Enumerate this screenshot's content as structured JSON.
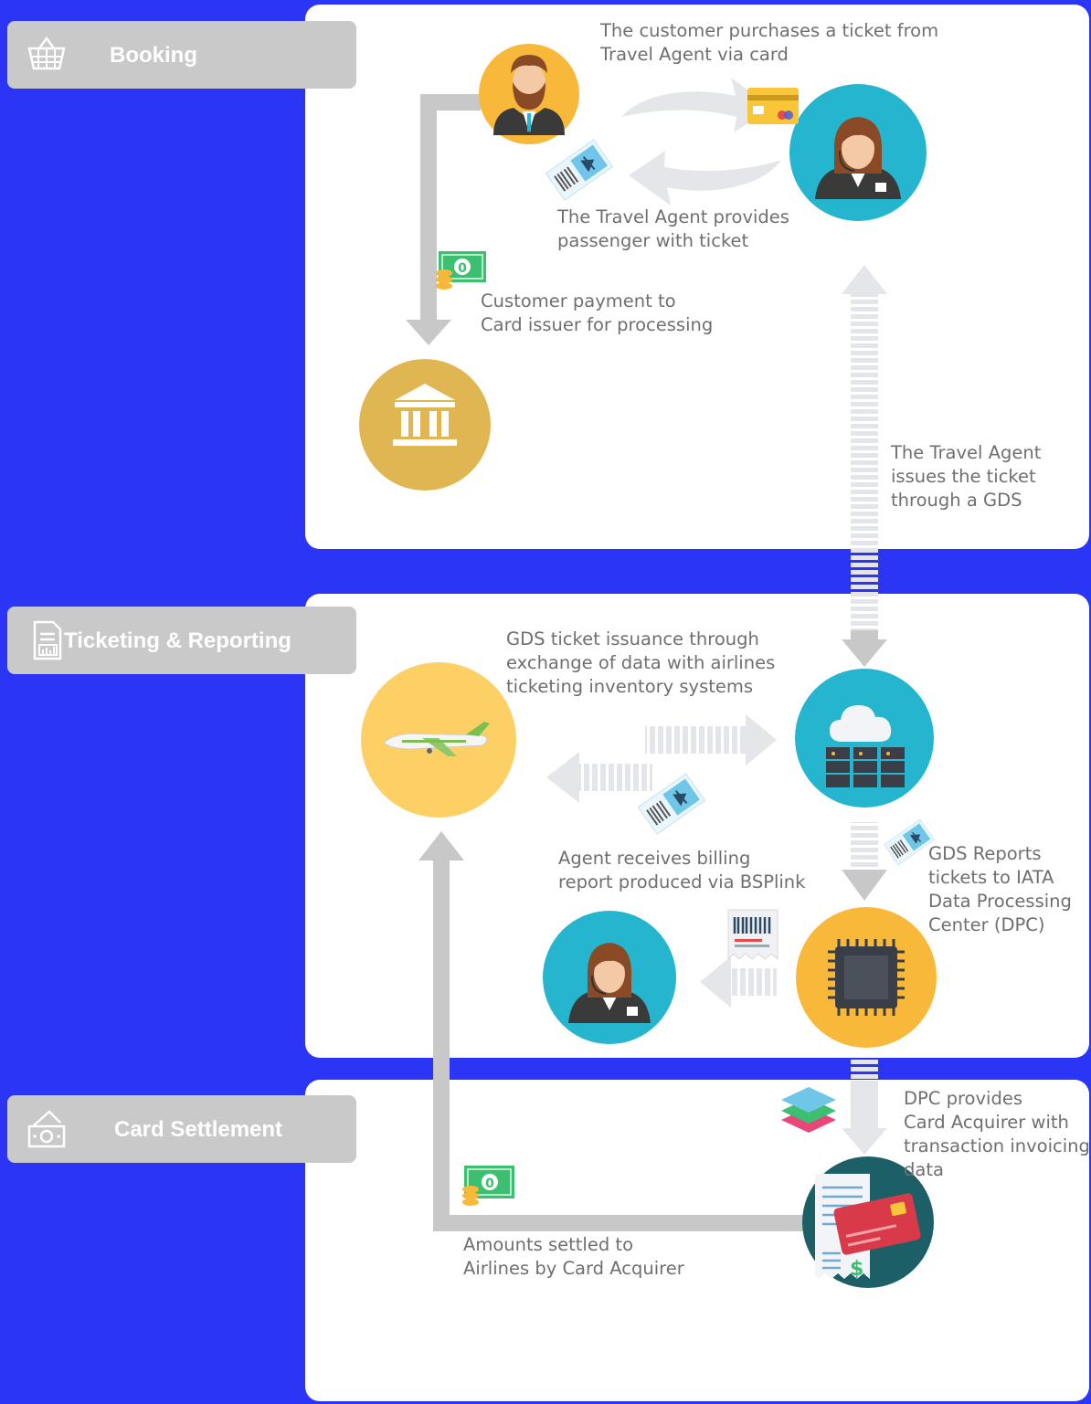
{
  "sections": {
    "booking": "Booking",
    "ticketing": "Ticketing & Reporting",
    "settlement": "Card Settlement"
  },
  "annotations": {
    "purchase": "The customer purchases a ticket from\nTravel Agent via card",
    "provides": "The Travel Agent provides\npassenger with ticket",
    "payment": "Customer payment to\nCard issuer for processing",
    "issues": "The Travel Agent\nissues the ticket\nthrough a GDS",
    "gds_issuance": "GDS ticket issuance through\nexchange of data with airlines\nticketing inventory systems",
    "billing": "Agent receives billing\nreport produced via BSPlink",
    "gds_reports": "GDS Reports\ntickets to IATA\nData Processing\nCenter (DPC)",
    "dpc_provides": "DPC provides\nCard Acquirer with\ntransaction invoicing\ndata",
    "settled": "Amounts settled to\nAirlines by Card Acquirer"
  },
  "icons": [
    "basket-icon",
    "report-icon",
    "cash-icon",
    "customer-icon",
    "travel-agent-icon",
    "bank-icon",
    "airplane-icon",
    "server-cloud-icon",
    "cpu-chip-icon",
    "receipt-card-icon",
    "ticket-icon",
    "credit-card-icon",
    "money-icon",
    "barcode-receipt-icon",
    "layers-icon"
  ],
  "colors": {
    "background": "#2b35f5",
    "panel": "#ffffff",
    "tab": "#c9c9c9",
    "orange": "#f8b93b",
    "teal": "#26b5cf",
    "gold": "#e0b652",
    "yellow": "#fdd065",
    "arrow_grey": "#c8c8c8",
    "arrow_light": "#e4e6ea"
  }
}
